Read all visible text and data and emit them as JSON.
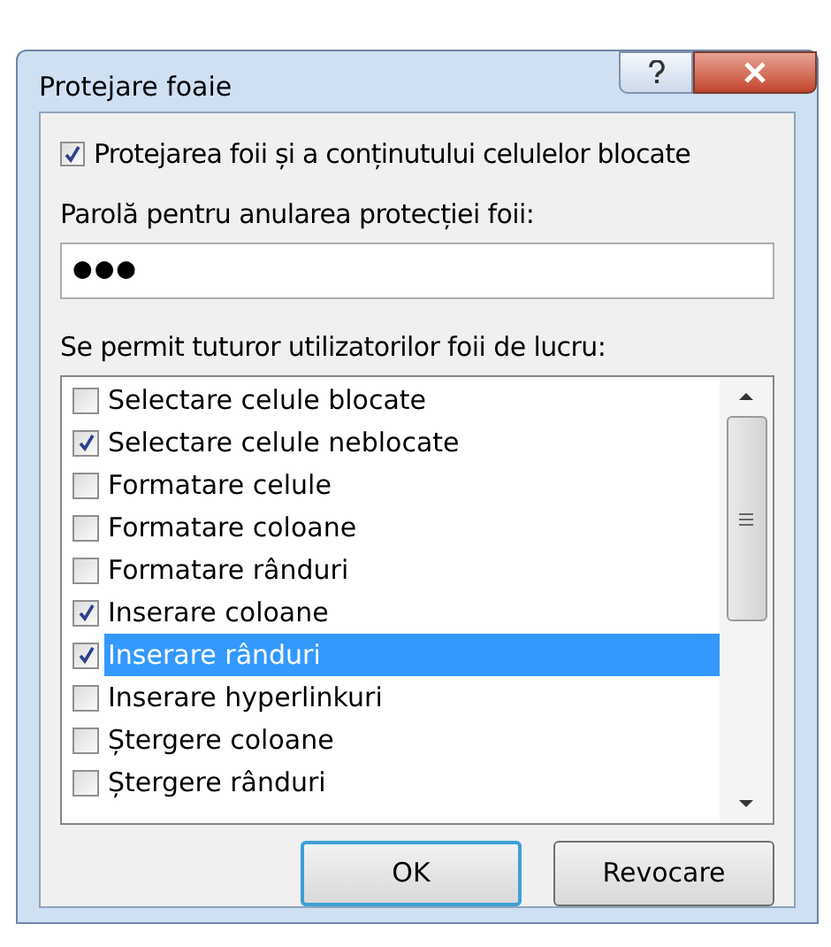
{
  "window": {
    "title": "Protejare foaie"
  },
  "protect": {
    "label": "Protejarea foii și a conținutului celulelor blocate",
    "checked": true
  },
  "password": {
    "label": "Parolă pentru anularea protecției foii:",
    "value": "●●●"
  },
  "permissions": {
    "label": "Se permit tuturor utilizatorilor foii de lucru:",
    "items": [
      {
        "label": "Selectare celule blocate",
        "checked": false,
        "selected": false
      },
      {
        "label": "Selectare celule neblocate",
        "checked": true,
        "selected": false
      },
      {
        "label": "Formatare celule",
        "checked": false,
        "selected": false
      },
      {
        "label": "Formatare coloane",
        "checked": false,
        "selected": false
      },
      {
        "label": "Formatare rânduri",
        "checked": false,
        "selected": false
      },
      {
        "label": "Inserare coloane",
        "checked": true,
        "selected": false
      },
      {
        "label": "Inserare rânduri",
        "checked": true,
        "selected": true
      },
      {
        "label": "Inserare hyperlinkuri",
        "checked": false,
        "selected": false
      },
      {
        "label": "Ștergere coloane",
        "checked": false,
        "selected": false
      },
      {
        "label": "Ștergere rânduri",
        "checked": false,
        "selected": false
      }
    ]
  },
  "buttons": [
    {
      "label": "OK",
      "default": true
    },
    {
      "label": "Revocare",
      "default": false
    }
  ]
}
